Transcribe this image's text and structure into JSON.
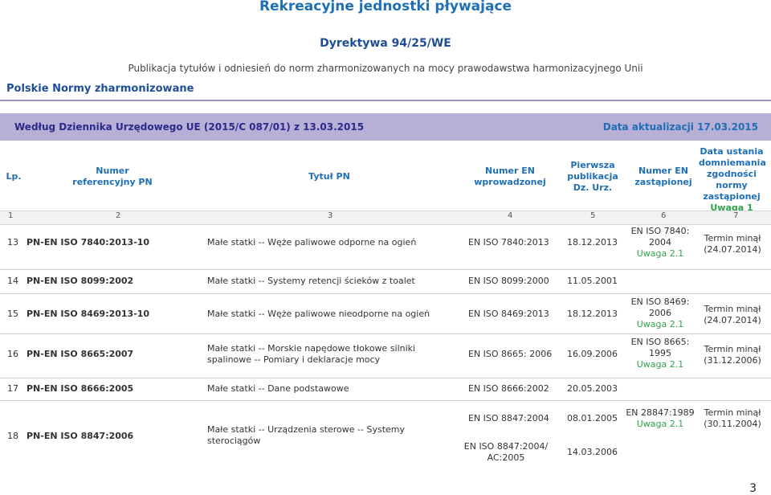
{
  "page": {
    "title": "Rekreacyjne jednostki pływające",
    "directive": "Dyrektywa 94/25/WE",
    "publication": "Publikacja tytułów i odniesień do norm zharmonizowanych na mocy prawodawstwa harmonizacyjnego Unii",
    "section_label": "Polskie Normy zharmonizowane",
    "banner_left": "Według Dziennika Urzędowego UE (2015/C 087/01) z 13.03.2015",
    "banner_right": "Data aktualizacji 17.03.2015",
    "page_number": "3"
  },
  "headers": {
    "lp": "Lp.",
    "numer_ref": "Numer referencyjny PN",
    "tytul": "Tytuł PN",
    "numer_en_wpr": "Numer EN wprowadzonej",
    "pierwsza_publ": "Pierwsza publikacja Dz. Urz.",
    "numer_en_zast": "Numer EN zastąpionej",
    "data_ustania": "Data ustania domniemania zgodności normy zastąpionej",
    "data_ustania_note": "Uwaga 1"
  },
  "col_numbers": [
    "1",
    "2",
    "3",
    "4",
    "5",
    "6",
    "7"
  ],
  "rows": [
    {
      "lp": "13",
      "pn": "PN-EN ISO 7840:2013-10",
      "title": "Małe statki -- Węże paliwowe odporne na ogień",
      "en": "EN ISO 7840:2013",
      "date": "18.12.2013",
      "repl_a": "EN ISO 7840:",
      "repl_b": "2004",
      "repl_note": "Uwaga 2.1",
      "expiry": "Termin minął",
      "expiry_date": "(24.07.2014)"
    },
    {
      "lp": "14",
      "pn": "PN-EN ISO 8099:2002",
      "title": "Małe statki -- Systemy retencji ścieków z toalet",
      "en": "EN ISO 8099:2000",
      "date": "11.05.2001"
    },
    {
      "lp": "15",
      "pn": "PN-EN ISO 8469:2013-10",
      "title": "Małe statki -- Węże paliwowe nieodporne na ogień",
      "en": "EN ISO 8469:2013",
      "date": "18.12.2013",
      "repl_a": "EN ISO 8469:",
      "repl_b": "2006",
      "repl_note": "Uwaga 2.1",
      "expiry": "Termin minął",
      "expiry_date": "(24.07.2014)"
    },
    {
      "lp": "16",
      "pn": "PN-EN ISO 8665:2007",
      "title_1": "Małe statki -- Morskie napędowe tłokowe silniki",
      "title_2": "spalinowe -- Pomiary i deklaracje mocy",
      "en": "EN ISO 8665: 2006",
      "date": "16.09.2006",
      "repl_a": "EN ISO 8665:",
      "repl_b": "1995",
      "repl_note": "Uwaga 2.1",
      "expiry": "Termin minął",
      "expiry_date": "(31.12.2006)"
    },
    {
      "lp": "17",
      "pn": "PN-EN ISO 8666:2005",
      "title": "Małe statki -- Dane podstawowe",
      "en": "EN ISO 8666:2002",
      "date": "20.05.2003"
    },
    {
      "lp": "18",
      "pn": "PN-EN ISO 8847:2006",
      "title_1": "Małe statki -- Urządzenia sterowe -- Systemy",
      "title_2": "sterociągów",
      "en_1": "EN ISO 8847:2004",
      "date_1": "08.01.2005",
      "en_2a": "EN ISO 8847:2004/",
      "en_2b": "AC:2005",
      "date_2": "14.03.2006",
      "repl_a": "EN 28847:1989",
      "repl_note": "Uwaga 2.1",
      "expiry": "Termin minął",
      "expiry_date": "(30.11.2004)"
    }
  ]
}
